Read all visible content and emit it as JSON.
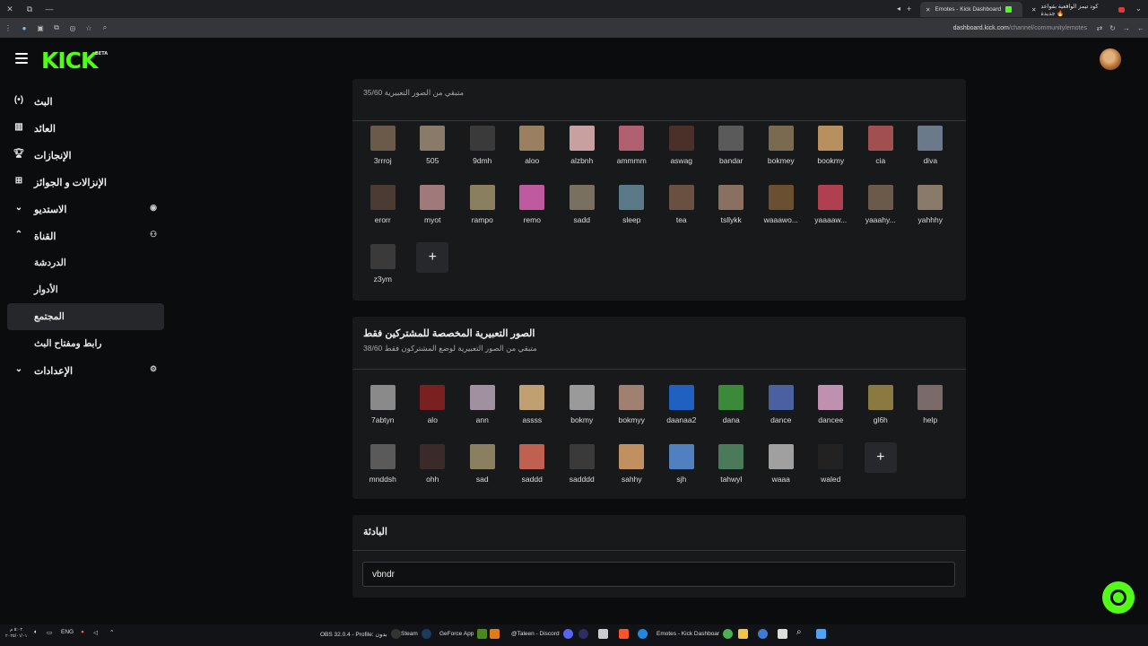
{
  "browser": {
    "tabs": [
      {
        "label": "Emotes - Kick Dashboard",
        "active": true
      },
      {
        "label": "كود تيمز الواقعية بقواعد جديدة 🔥",
        "active": false
      }
    ],
    "url_host": "dashboard.kick.com",
    "url_path": "/channel/community/emotes"
  },
  "app": {
    "logo": "KICK",
    "logo_badge": "BETA",
    "brand_color": "#53fc18"
  },
  "sidebar": {
    "items": [
      {
        "label": "البث",
        "icon": "broadcast-icon"
      },
      {
        "label": "العائد",
        "icon": "revenue-icon"
      },
      {
        "label": "الإنجازات",
        "icon": "trophy-icon"
      },
      {
        "label": "الإنزالات و الجوائز",
        "icon": "drops-icon"
      },
      {
        "label": "الاستديو",
        "icon": "chevron-down-icon",
        "right_icon": "studio-icon"
      },
      {
        "label": "القناة",
        "icon": "chevron-up-icon",
        "right_icon": "channel-icon"
      }
    ],
    "subitems": [
      "الدردشة",
      "الأدوار",
      "المجتمع",
      "رابط ومفتاح البث"
    ],
    "settings": {
      "label": "الإعدادات",
      "icon": "chevron-down-icon",
      "right_icon": "gear-icon"
    }
  },
  "emotes_section": {
    "title_fragment": "... ...",
    "subtitle": "متبقي من الصور التعبيرية 35/60",
    "emotes": [
      "3rrroj",
      "505",
      "9dmh",
      "aloo",
      "alzbnh",
      "ammmm",
      "aswag",
      "bandar",
      "bokmey",
      "bookmy",
      "cia",
      "diva",
      "erorr",
      "myot",
      "rampo",
      "remo",
      "sadd",
      "sleep",
      "tea",
      "tsllykk",
      "waaawo...",
      "yaaaaw...",
      "yaaahy...",
      "yahhhy",
      "z3ym"
    ]
  },
  "sub_emotes_section": {
    "title": "الصور التعبيرية المخصصة للمشتركين فقط",
    "subtitle": "متبقي من الصور التعبيرية لوضع المشتركون فقط 38/60",
    "emotes": [
      "7abtyn",
      "alo",
      "ann",
      "assss",
      "bokmy",
      "bokmyy",
      "daanaa2",
      "dana",
      "dance",
      "dancee",
      "gl6h",
      "help",
      "mnddsh",
      "ohh",
      "sad",
      "saddd",
      "sadddd",
      "sahhy",
      "sjh",
      "tahwyl",
      "waaa",
      "waled"
    ]
  },
  "prefix_section": {
    "title": "البادئة",
    "value": "vbndr"
  },
  "taskbar": {
    "time": "٥:٠٢ م",
    "date": "٢٠٢٥/٠١/٠١",
    "lang": "ENG",
    "apps": [
      "OBS 32.0.4 - Profile: بدون",
      "Steam",
      "GeForce App",
      "@Taleen - Discord",
      "Emotes - Kick Dashboar"
    ]
  }
}
